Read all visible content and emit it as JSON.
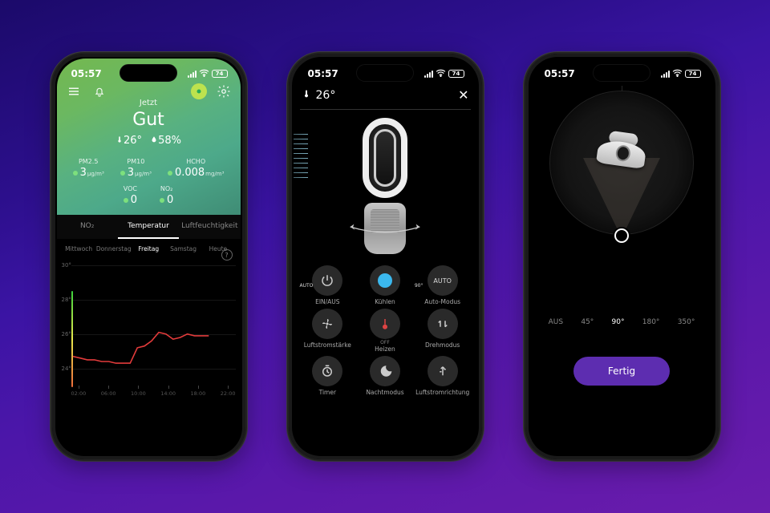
{
  "status": {
    "time": "05:57",
    "battery": "74"
  },
  "phone1": {
    "now": "Jetzt",
    "quality": "Gut",
    "temp": "26°",
    "humidity": "58%",
    "metrics": [
      {
        "label": "PM2.5",
        "value": "3",
        "unit": "µg/m³"
      },
      {
        "label": "PM10",
        "value": "3",
        "unit": "µg/m³"
      },
      {
        "label": "HCHO",
        "value": "0.008",
        "unit": "mg/m³"
      }
    ],
    "metrics2": [
      {
        "label": "VOC",
        "value": "0"
      },
      {
        "label": "NO₂",
        "value": "0"
      }
    ],
    "tabs": [
      "NO₂",
      "Temperatur",
      "Luftfeuchtigkeit"
    ],
    "active_tab": 1,
    "days": [
      "Mittwoch",
      "Donnerstag",
      "Freitag",
      "Samstag",
      "Heute"
    ],
    "active_day": 2,
    "x_ticks": [
      "02:00",
      "06:00",
      "10:00",
      "14:00",
      "18:00",
      "22:00"
    ]
  },
  "phone2": {
    "temp": "26°",
    "controls": [
      {
        "name": "power",
        "label": "EIN/AUS",
        "icon": "power"
      },
      {
        "name": "cool",
        "label": "Kühlen",
        "icon": "cool"
      },
      {
        "name": "auto",
        "label": "Auto-Modus",
        "icon": "auto"
      },
      {
        "name": "airflow",
        "label": "Luftstromstärke",
        "icon": "fan",
        "badge": "AUTO"
      },
      {
        "name": "heat",
        "label": "Heizen",
        "icon": "thermo",
        "sub": "OFF"
      },
      {
        "name": "oscillate",
        "label": "Drehmodus",
        "icon": "oscillate",
        "badge": "90°"
      },
      {
        "name": "timer",
        "label": "Timer",
        "icon": "timer"
      },
      {
        "name": "night",
        "label": "Nachtmodus",
        "icon": "night"
      },
      {
        "name": "direction",
        "label": "Luftstromrichtung",
        "icon": "direction"
      }
    ]
  },
  "phone3": {
    "angles": [
      "AUS",
      "45°",
      "90°",
      "180°",
      "350°"
    ],
    "active_angle": 2,
    "done": "Fertig"
  },
  "chart_data": {
    "type": "line",
    "title": "Temperatur",
    "xlabel": "",
    "ylabel": "°C",
    "ylim": [
      23,
      30
    ],
    "y_ticks": [
      30,
      28,
      26,
      24
    ],
    "x": [
      "00:00",
      "01:00",
      "02:00",
      "03:00",
      "04:00",
      "05:00",
      "06:00",
      "07:00",
      "08:00",
      "09:00",
      "10:00",
      "11:00",
      "12:00",
      "13:00",
      "14:00",
      "15:00",
      "16:00",
      "17:00",
      "18:00",
      "19:00",
      "20:00",
      "21:00",
      "22:00",
      "23:00"
    ],
    "series": [
      {
        "name": "Temperatur",
        "color": "#e23b3b",
        "values": [
          24.7,
          24.6,
          24.5,
          24.5,
          24.4,
          24.4,
          24.3,
          24.3,
          24.3,
          25.2,
          25.3,
          25.6,
          26.1,
          26.0,
          25.7,
          25.8,
          26.0,
          25.9,
          25.9,
          25.9,
          null,
          null,
          null,
          null
        ]
      }
    ]
  }
}
